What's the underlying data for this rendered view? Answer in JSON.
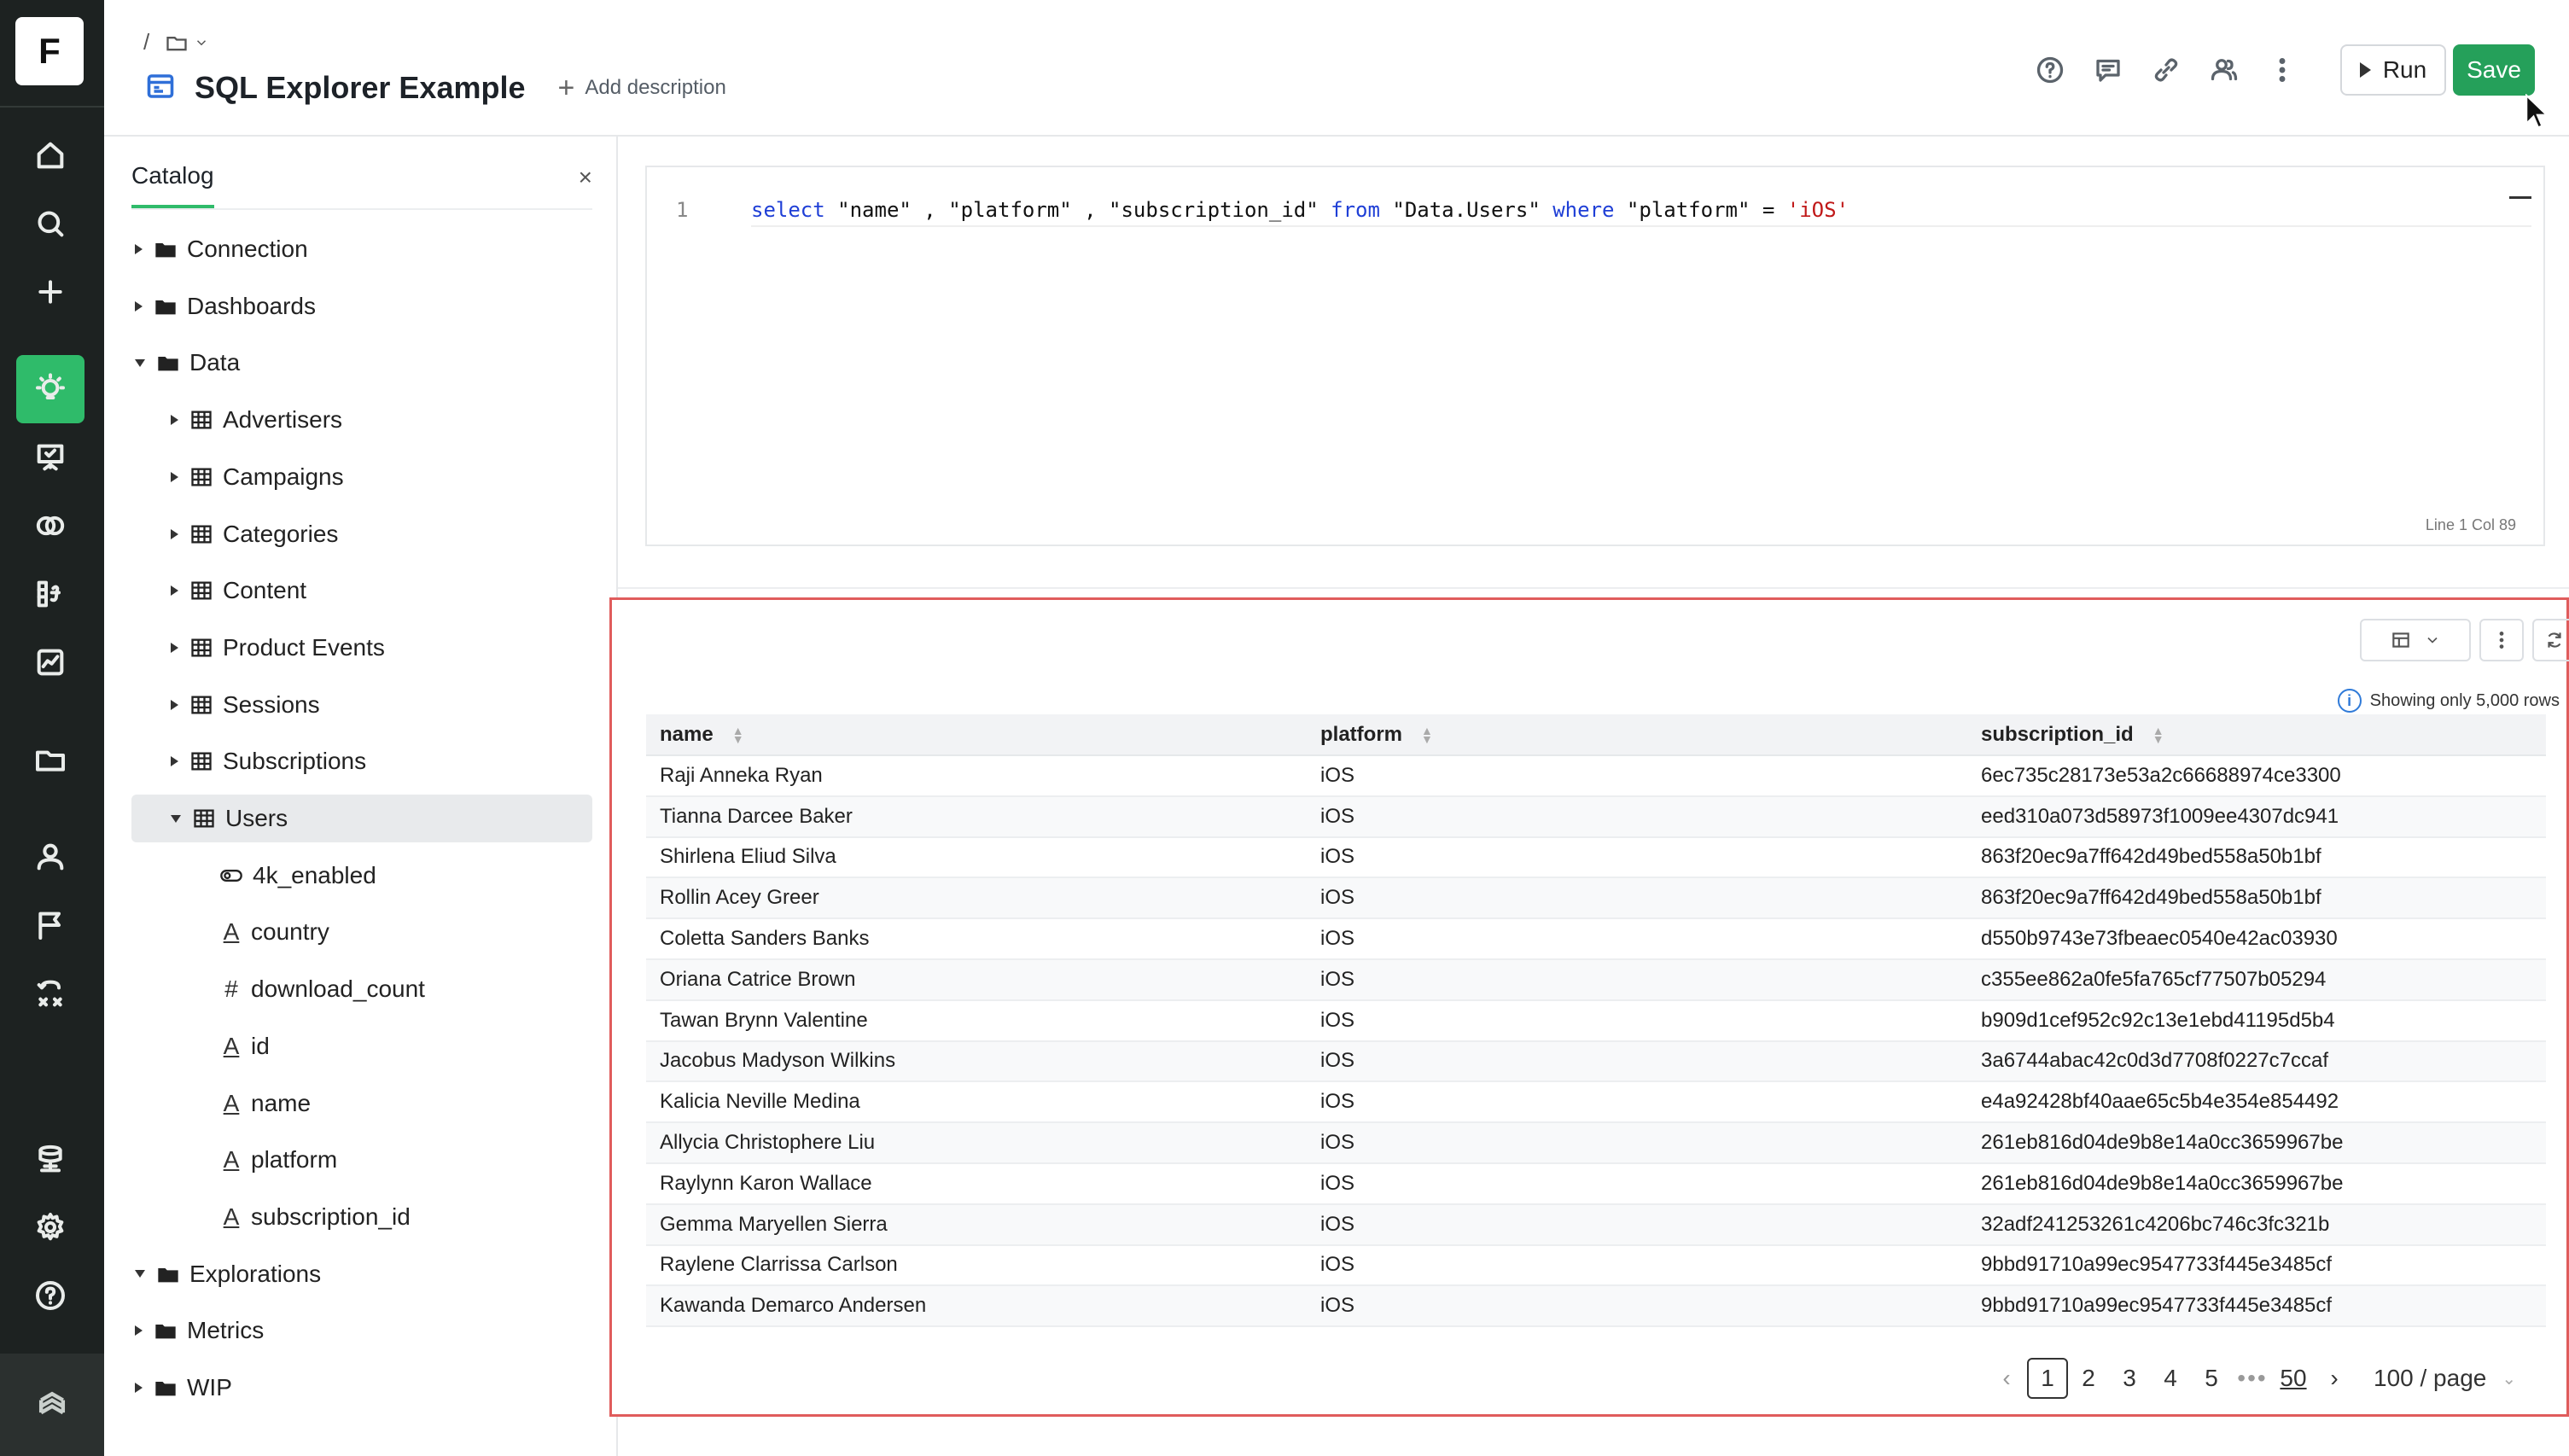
{
  "app": {
    "logo_letter": "F"
  },
  "breadcrumb": {
    "root": "/"
  },
  "header": {
    "title": "SQL Explorer Example",
    "add_description": "Add description",
    "run_label": "Run",
    "save_label": "Save"
  },
  "rail": {
    "items": [
      "home-icon",
      "search-icon",
      "plus-icon",
      "explorer-icon",
      "presentation-icon",
      "circles-icon",
      "formula-icon",
      "chart-icon",
      "folder-icon",
      "user-icon",
      "flag-icon",
      "workflow-icon",
      "database-icon",
      "settings-icon",
      "help-icon"
    ],
    "active": "explorer-icon",
    "accent": "#2fbb6a"
  },
  "catalog": {
    "tab": "Catalog",
    "close": "×",
    "nodes": [
      {
        "label": "Connection",
        "kind": "folder",
        "level": 0,
        "expanded": false
      },
      {
        "label": "Dashboards",
        "kind": "folder",
        "level": 0,
        "expanded": false
      },
      {
        "label": "Data",
        "kind": "folder",
        "level": 0,
        "expanded": true
      },
      {
        "label": "Advertisers",
        "kind": "table",
        "level": 1,
        "expanded": false
      },
      {
        "label": "Campaigns",
        "kind": "table",
        "level": 1,
        "expanded": false
      },
      {
        "label": "Categories",
        "kind": "table",
        "level": 1,
        "expanded": false
      },
      {
        "label": "Content",
        "kind": "table",
        "level": 1,
        "expanded": false
      },
      {
        "label": "Product Events",
        "kind": "table",
        "level": 1,
        "expanded": false
      },
      {
        "label": "Sessions",
        "kind": "table",
        "level": 1,
        "expanded": false
      },
      {
        "label": "Subscriptions",
        "kind": "table",
        "level": 1,
        "expanded": false
      },
      {
        "label": "Users",
        "kind": "table",
        "level": 1,
        "expanded": true,
        "selected": true
      },
      {
        "label": "4k_enabled",
        "kind": "bool",
        "level": 2
      },
      {
        "label": "country",
        "kind": "text",
        "level": 2
      },
      {
        "label": "download_count",
        "kind": "number",
        "level": 2
      },
      {
        "label": "id",
        "kind": "text",
        "level": 2
      },
      {
        "label": "name",
        "kind": "text",
        "level": 2
      },
      {
        "label": "platform",
        "kind": "text",
        "level": 2
      },
      {
        "label": "subscription_id",
        "kind": "text",
        "level": 2
      },
      {
        "label": "Explorations",
        "kind": "folder",
        "level": 0,
        "expanded": true
      },
      {
        "label": "Metrics",
        "kind": "folder",
        "level": 0,
        "expanded": false
      },
      {
        "label": "WIP",
        "kind": "folder",
        "level": 0,
        "expanded": false
      }
    ]
  },
  "editor": {
    "line_number": "1",
    "query_tokens": [
      {
        "t": "select",
        "c": "kw"
      },
      {
        "t": " \"name\" , \"platform\" , \"subscription_id\" ",
        "c": ""
      },
      {
        "t": "from",
        "c": "kw"
      },
      {
        "t": " \"Data.Users\" ",
        "c": ""
      },
      {
        "t": "where",
        "c": "kw"
      },
      {
        "t": " \"platform\" = ",
        "c": ""
      },
      {
        "t": "'iOS'",
        "c": "str"
      }
    ],
    "cursor_position": "Line 1 Col 89"
  },
  "results": {
    "notice": "Showing only 5,000 rows",
    "columns": [
      "name",
      "platform",
      "subscription_id"
    ],
    "rows": [
      [
        "Raji Anneka Ryan",
        "iOS",
        "6ec735c28173e53a2c66688974ce3300"
      ],
      [
        "Tianna Darcee Baker",
        "iOS",
        "eed310a073d58973f1009ee4307dc941"
      ],
      [
        "Shirlena Eliud Silva",
        "iOS",
        "863f20ec9a7ff642d49bed558a50b1bf"
      ],
      [
        "Rollin Acey Greer",
        "iOS",
        "863f20ec9a7ff642d49bed558a50b1bf"
      ],
      [
        "Coletta Sanders Banks",
        "iOS",
        "d550b9743e73fbeaec0540e42ac03930"
      ],
      [
        "Oriana Catrice Brown",
        "iOS",
        "c355ee862a0fe5fa765cf77507b05294"
      ],
      [
        "Tawan Brynn Valentine",
        "iOS",
        "b909d1cef952c92c13e1ebd41195d5b4"
      ],
      [
        "Jacobus Madyson Wilkins",
        "iOS",
        "3a6744abac42c0d3d7708f0227c7ccaf"
      ],
      [
        "Kalicia Neville Medina",
        "iOS",
        "e4a92428bf40aae65c5b4e354e854492"
      ],
      [
        "Allycia Christophere Liu",
        "iOS",
        "261eb816d04de9b8e14a0cc3659967be"
      ],
      [
        "Raylynn Karon Wallace",
        "iOS",
        "261eb816d04de9b8e14a0cc3659967be"
      ],
      [
        "Gemma Maryellen Sierra",
        "iOS",
        "32adf241253261c4206bc746c3fc321b"
      ],
      [
        "Raylene Clarrissa Carlson",
        "iOS",
        "9bbd91710a99ec9547733f445e3485cf"
      ],
      [
        "Kawanda Demarco Andersen",
        "iOS",
        "9bbd91710a99ec9547733f445e3485cf"
      ]
    ],
    "pagination": {
      "pages": [
        "1",
        "2",
        "3",
        "4",
        "5"
      ],
      "ellipsis": "•••",
      "last": "50",
      "current": "1",
      "page_size": "100 / page"
    }
  }
}
